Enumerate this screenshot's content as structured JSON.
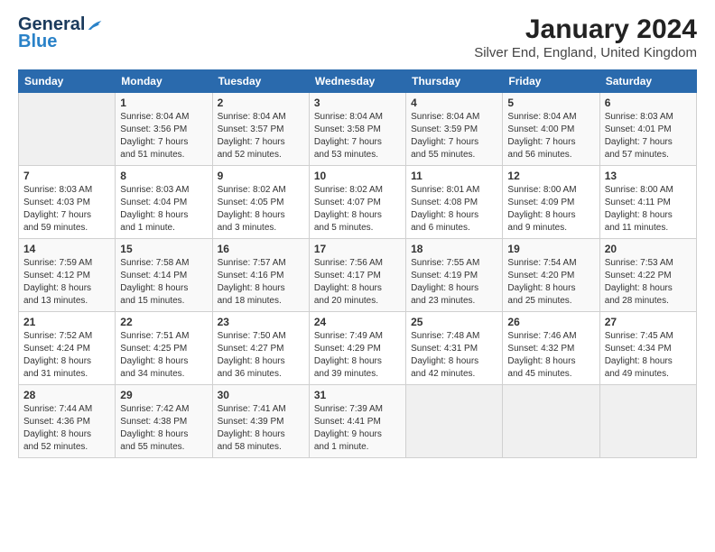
{
  "header": {
    "logo_line1": "General",
    "logo_line2": "Blue",
    "main_title": "January 2024",
    "subtitle": "Silver End, England, United Kingdom"
  },
  "calendar": {
    "days_of_week": [
      "Sunday",
      "Monday",
      "Tuesday",
      "Wednesday",
      "Thursday",
      "Friday",
      "Saturday"
    ],
    "weeks": [
      [
        {
          "day": "",
          "info": ""
        },
        {
          "day": "1",
          "info": "Sunrise: 8:04 AM\nSunset: 3:56 PM\nDaylight: 7 hours\nand 51 minutes."
        },
        {
          "day": "2",
          "info": "Sunrise: 8:04 AM\nSunset: 3:57 PM\nDaylight: 7 hours\nand 52 minutes."
        },
        {
          "day": "3",
          "info": "Sunrise: 8:04 AM\nSunset: 3:58 PM\nDaylight: 7 hours\nand 53 minutes."
        },
        {
          "day": "4",
          "info": "Sunrise: 8:04 AM\nSunset: 3:59 PM\nDaylight: 7 hours\nand 55 minutes."
        },
        {
          "day": "5",
          "info": "Sunrise: 8:04 AM\nSunset: 4:00 PM\nDaylight: 7 hours\nand 56 minutes."
        },
        {
          "day": "6",
          "info": "Sunrise: 8:03 AM\nSunset: 4:01 PM\nDaylight: 7 hours\nand 57 minutes."
        }
      ],
      [
        {
          "day": "7",
          "info": "Sunrise: 8:03 AM\nSunset: 4:03 PM\nDaylight: 7 hours\nand 59 minutes."
        },
        {
          "day": "8",
          "info": "Sunrise: 8:03 AM\nSunset: 4:04 PM\nDaylight: 8 hours\nand 1 minute."
        },
        {
          "day": "9",
          "info": "Sunrise: 8:02 AM\nSunset: 4:05 PM\nDaylight: 8 hours\nand 3 minutes."
        },
        {
          "day": "10",
          "info": "Sunrise: 8:02 AM\nSunset: 4:07 PM\nDaylight: 8 hours\nand 5 minutes."
        },
        {
          "day": "11",
          "info": "Sunrise: 8:01 AM\nSunset: 4:08 PM\nDaylight: 8 hours\nand 6 minutes."
        },
        {
          "day": "12",
          "info": "Sunrise: 8:00 AM\nSunset: 4:09 PM\nDaylight: 8 hours\nand 9 minutes."
        },
        {
          "day": "13",
          "info": "Sunrise: 8:00 AM\nSunset: 4:11 PM\nDaylight: 8 hours\nand 11 minutes."
        }
      ],
      [
        {
          "day": "14",
          "info": "Sunrise: 7:59 AM\nSunset: 4:12 PM\nDaylight: 8 hours\nand 13 minutes."
        },
        {
          "day": "15",
          "info": "Sunrise: 7:58 AM\nSunset: 4:14 PM\nDaylight: 8 hours\nand 15 minutes."
        },
        {
          "day": "16",
          "info": "Sunrise: 7:57 AM\nSunset: 4:16 PM\nDaylight: 8 hours\nand 18 minutes."
        },
        {
          "day": "17",
          "info": "Sunrise: 7:56 AM\nSunset: 4:17 PM\nDaylight: 8 hours\nand 20 minutes."
        },
        {
          "day": "18",
          "info": "Sunrise: 7:55 AM\nSunset: 4:19 PM\nDaylight: 8 hours\nand 23 minutes."
        },
        {
          "day": "19",
          "info": "Sunrise: 7:54 AM\nSunset: 4:20 PM\nDaylight: 8 hours\nand 25 minutes."
        },
        {
          "day": "20",
          "info": "Sunrise: 7:53 AM\nSunset: 4:22 PM\nDaylight: 8 hours\nand 28 minutes."
        }
      ],
      [
        {
          "day": "21",
          "info": "Sunrise: 7:52 AM\nSunset: 4:24 PM\nDaylight: 8 hours\nand 31 minutes."
        },
        {
          "day": "22",
          "info": "Sunrise: 7:51 AM\nSunset: 4:25 PM\nDaylight: 8 hours\nand 34 minutes."
        },
        {
          "day": "23",
          "info": "Sunrise: 7:50 AM\nSunset: 4:27 PM\nDaylight: 8 hours\nand 36 minutes."
        },
        {
          "day": "24",
          "info": "Sunrise: 7:49 AM\nSunset: 4:29 PM\nDaylight: 8 hours\nand 39 minutes."
        },
        {
          "day": "25",
          "info": "Sunrise: 7:48 AM\nSunset: 4:31 PM\nDaylight: 8 hours\nand 42 minutes."
        },
        {
          "day": "26",
          "info": "Sunrise: 7:46 AM\nSunset: 4:32 PM\nDaylight: 8 hours\nand 45 minutes."
        },
        {
          "day": "27",
          "info": "Sunrise: 7:45 AM\nSunset: 4:34 PM\nDaylight: 8 hours\nand 49 minutes."
        }
      ],
      [
        {
          "day": "28",
          "info": "Sunrise: 7:44 AM\nSunset: 4:36 PM\nDaylight: 8 hours\nand 52 minutes."
        },
        {
          "day": "29",
          "info": "Sunrise: 7:42 AM\nSunset: 4:38 PM\nDaylight: 8 hours\nand 55 minutes."
        },
        {
          "day": "30",
          "info": "Sunrise: 7:41 AM\nSunset: 4:39 PM\nDaylight: 8 hours\nand 58 minutes."
        },
        {
          "day": "31",
          "info": "Sunrise: 7:39 AM\nSunset: 4:41 PM\nDaylight: 9 hours\nand 1 minute."
        },
        {
          "day": "",
          "info": ""
        },
        {
          "day": "",
          "info": ""
        },
        {
          "day": "",
          "info": ""
        }
      ]
    ]
  }
}
